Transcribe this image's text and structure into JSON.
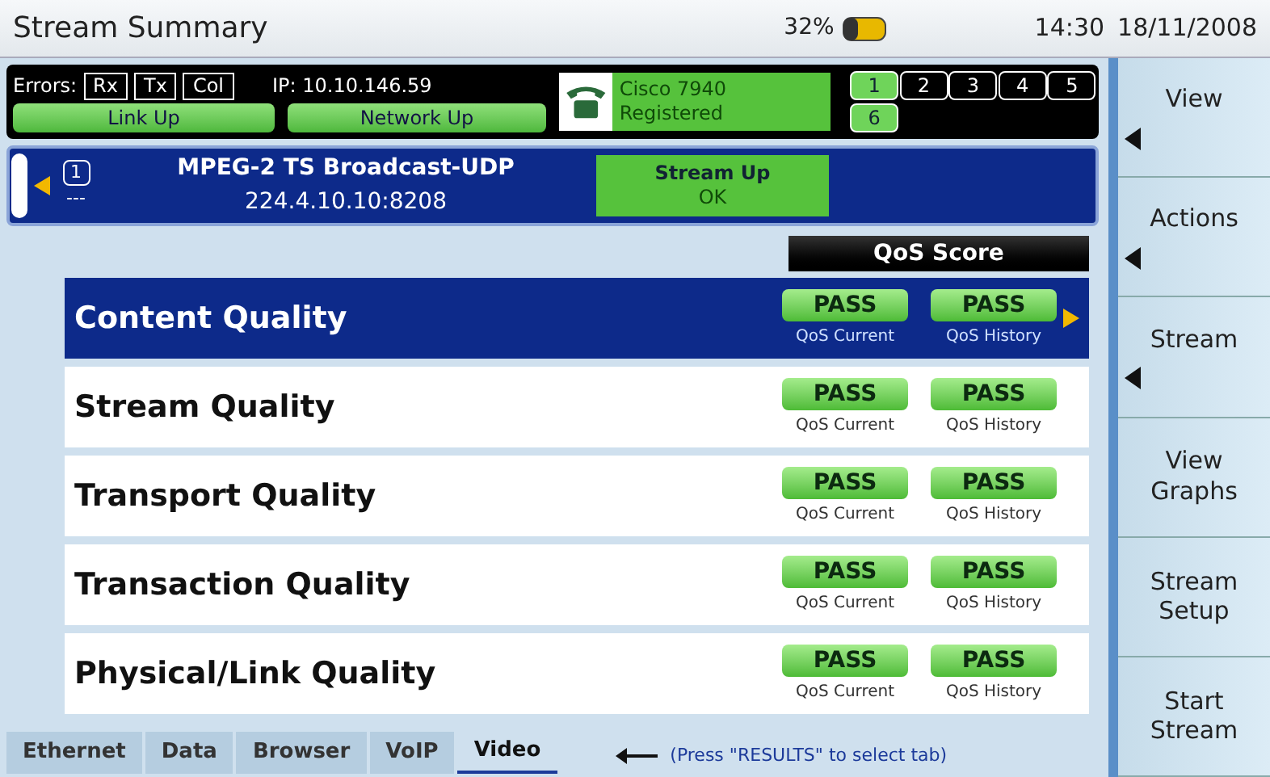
{
  "window": {
    "title": "Stream Summary",
    "battery": "32%",
    "time": "14:30",
    "date": "18/11/2008"
  },
  "status": {
    "errors_label": "Errors:",
    "errors": [
      "Rx",
      "Tx",
      "Col"
    ],
    "ip": "IP: 10.10.146.59",
    "link": "Link Up",
    "network": "Network Up",
    "phone": {
      "name": "Cisco 7940",
      "state": "Registered"
    },
    "ports": [
      {
        "label": "1",
        "active": true
      },
      {
        "label": "2",
        "active": false
      },
      {
        "label": "3",
        "active": false
      },
      {
        "label": "4",
        "active": false
      },
      {
        "label": "5",
        "active": false
      },
      {
        "label": "6",
        "active": true
      }
    ]
  },
  "stream": {
    "index": "1",
    "sub": "---",
    "name": "MPEG-2 TS Broadcast-UDP",
    "address": "224.4.10.10:8208",
    "state": "Stream Up",
    "state_detail": "OK"
  },
  "qos_header": "QoS Score",
  "rows": [
    {
      "name": "Content Quality",
      "selected": true,
      "current": "PASS",
      "current_label": "QoS Current",
      "history": "PASS",
      "history_label": "QoS History"
    },
    {
      "name": "Stream Quality",
      "selected": false,
      "current": "PASS",
      "current_label": "QoS Current",
      "history": "PASS",
      "history_label": "QoS History"
    },
    {
      "name": "Transport Quality",
      "selected": false,
      "current": "PASS",
      "current_label": "QoS Current",
      "history": "PASS",
      "history_label": "QoS History"
    },
    {
      "name": "Transaction Quality",
      "selected": false,
      "current": "PASS",
      "current_label": "QoS Current",
      "history": "PASS",
      "history_label": "QoS History"
    },
    {
      "name": "Physical/Link Quality",
      "selected": false,
      "current": "PASS",
      "current_label": "QoS Current",
      "history": "PASS",
      "history_label": "QoS History"
    }
  ],
  "tabs": [
    {
      "label": "Ethernet",
      "selected": false
    },
    {
      "label": "Data",
      "selected": false
    },
    {
      "label": "Browser",
      "selected": false
    },
    {
      "label": "VoIP",
      "selected": false
    },
    {
      "label": "Video",
      "selected": true
    }
  ],
  "hint": "(Press \"RESULTS\" to select tab)",
  "softkeys": [
    {
      "label": "View",
      "submenu": true
    },
    {
      "label": "Actions",
      "submenu": true
    },
    {
      "label": "Stream",
      "submenu": true
    },
    {
      "label": "View Graphs",
      "submenu": false
    },
    {
      "label": "Stream Setup",
      "submenu": false
    },
    {
      "label": "Start Stream",
      "submenu": false
    }
  ]
}
